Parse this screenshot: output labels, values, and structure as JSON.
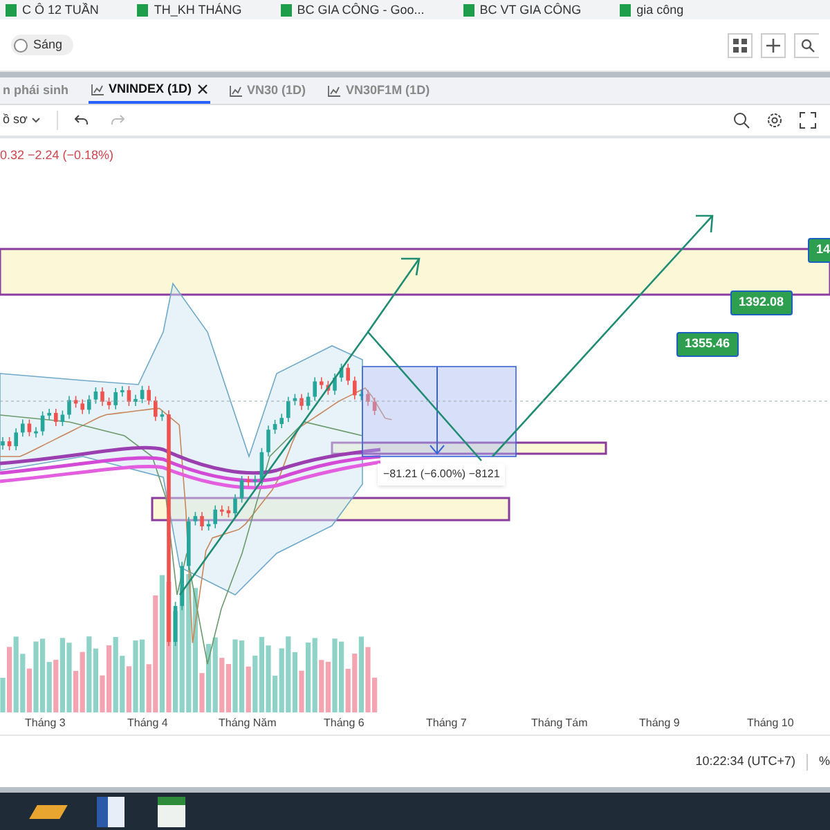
{
  "bookmarks": [
    "C Ô 12 TUẦN",
    "TH_KH THÁNG",
    "BC GIA CÔNG - Goo...",
    "BC VT GIA CÔNG",
    "gia công"
  ],
  "theme_toggle": {
    "label": "Sáng",
    "on": false
  },
  "tabs": [
    {
      "label": "n phái sinh",
      "selected": false,
      "closable": false,
      "icon": false
    },
    {
      "label": "VNINDEX (1D)",
      "selected": true,
      "closable": true,
      "icon": true
    },
    {
      "label": "VN30 (1D)",
      "selected": false,
      "closable": false,
      "icon": true
    },
    {
      "label": "VN30F1M (1D)",
      "selected": false,
      "closable": false,
      "icon": true
    }
  ],
  "chart_toolbar": {
    "menu_label": "ồ sơ"
  },
  "price_change": "0.32 −2.24 (−0.18%)",
  "price_labels": [
    "14",
    "1392.08",
    "1355.46"
  ],
  "measure_label": "−81.21 (−6.00%) −8121",
  "x_axis": [
    "Tháng 3",
    "Tháng 4",
    "Tháng Năm",
    "Tháng 6",
    "Tháng 7",
    "Tháng Tám",
    "Tháng 9",
    "Tháng 10"
  ],
  "status_bar": {
    "time": "10:22:34 (UTC+7)",
    "extra": "%"
  }
}
